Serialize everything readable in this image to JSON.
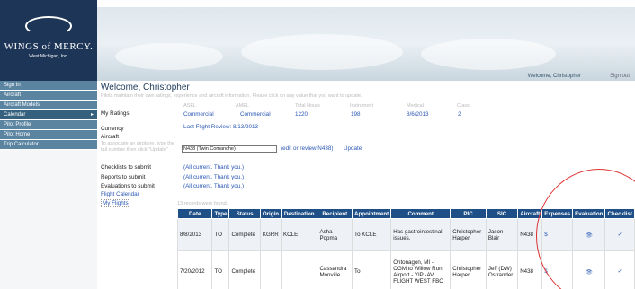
{
  "logo": {
    "line1": "WINGS of MERCY.",
    "line2": "West Michigan, Inc."
  },
  "header": {
    "welcome": "Welcome, Christopher",
    "signout": "Sign out"
  },
  "sidebar": {
    "items": [
      {
        "label": "Sign In"
      },
      {
        "label": "Aircraft"
      },
      {
        "label": "Aircraft Models"
      },
      {
        "label": "Calendar",
        "arrow": "▸"
      },
      {
        "label": "Pilot Profile"
      },
      {
        "label": "Pilot Home"
      },
      {
        "label": "Trip Calculator"
      }
    ]
  },
  "page": {
    "title": "Welcome, Christopher",
    "subtitle": "Pilots maintain their own ratings, experience and aircraft information. Please click on any value that you want to update."
  },
  "ratings": {
    "label": "My Ratings",
    "headers": [
      "ASEL",
      "AMEL",
      "Total Hours",
      "Instrument",
      "Medical",
      "Class"
    ],
    "values": [
      "Commercial",
      "Commercial",
      "1220",
      "198",
      "8/6/2013",
      "2"
    ]
  },
  "currency": {
    "label": "Currency",
    "value": "Last Flight Review: 8/13/2013"
  },
  "aircraft": {
    "label": "Aircraft",
    "hint": "To associate an airplane, type the tail number then click \"Update\"",
    "input_value": "N438 (Twin Comanche)",
    "edit_link": "(edit or review N438)",
    "update_link": "Update"
  },
  "submits": [
    {
      "label": "Checklists to submit",
      "value": "(All current. Thank you.)"
    },
    {
      "label": "Reports to submit",
      "value": "(All current. Thank you.)"
    },
    {
      "label": "Evaluations to submit",
      "value": "(All current. Thank you.)"
    }
  ],
  "links": {
    "calendar": "Flight Calendar",
    "flights": "My Flights"
  },
  "records": {
    "count_text": "13 records were found.",
    "columns": [
      "Date",
      "Type",
      "Status",
      "Origin",
      "Destination",
      "Recipient",
      "Appointment",
      "Comment",
      "PIC",
      "SIC",
      "Aircraft",
      "Expenses",
      "Evaluation",
      "Checklist"
    ],
    "rows": [
      {
        "date": "8/8/2013",
        "type": "TO",
        "status": "Complete",
        "origin": "KGRR",
        "destination": "KCLE",
        "recipient": "Asha Popma",
        "appointment": "To KCLE",
        "comment": "Has gastrointestinal issues.",
        "pic": "Christopher Harper",
        "sic": "Jason Blair",
        "aircraft": "N438",
        "expenses": "$",
        "evaluation": "👁",
        "checklist": "✓"
      },
      {
        "date": "7/20/2012",
        "type": "TO",
        "status": "Complete",
        "origin": "",
        "destination": "",
        "recipient": "Cassandra Monville",
        "appointment": "To",
        "comment": "Ontonagon, MI - OGM to Willow Run Airport - YIP -AV FLIGHT WEST FBO",
        "pic": "Christopher Harper",
        "sic": "Jeff (DW) Ostrander",
        "aircraft": "N438",
        "expenses": "$",
        "evaluation": "👁",
        "checklist": "✓"
      }
    ]
  },
  "colors": {
    "nav": "#5a84a0",
    "table_header": "#1f4f87",
    "link": "#2a57b4",
    "annotation_circle": "#d33"
  }
}
